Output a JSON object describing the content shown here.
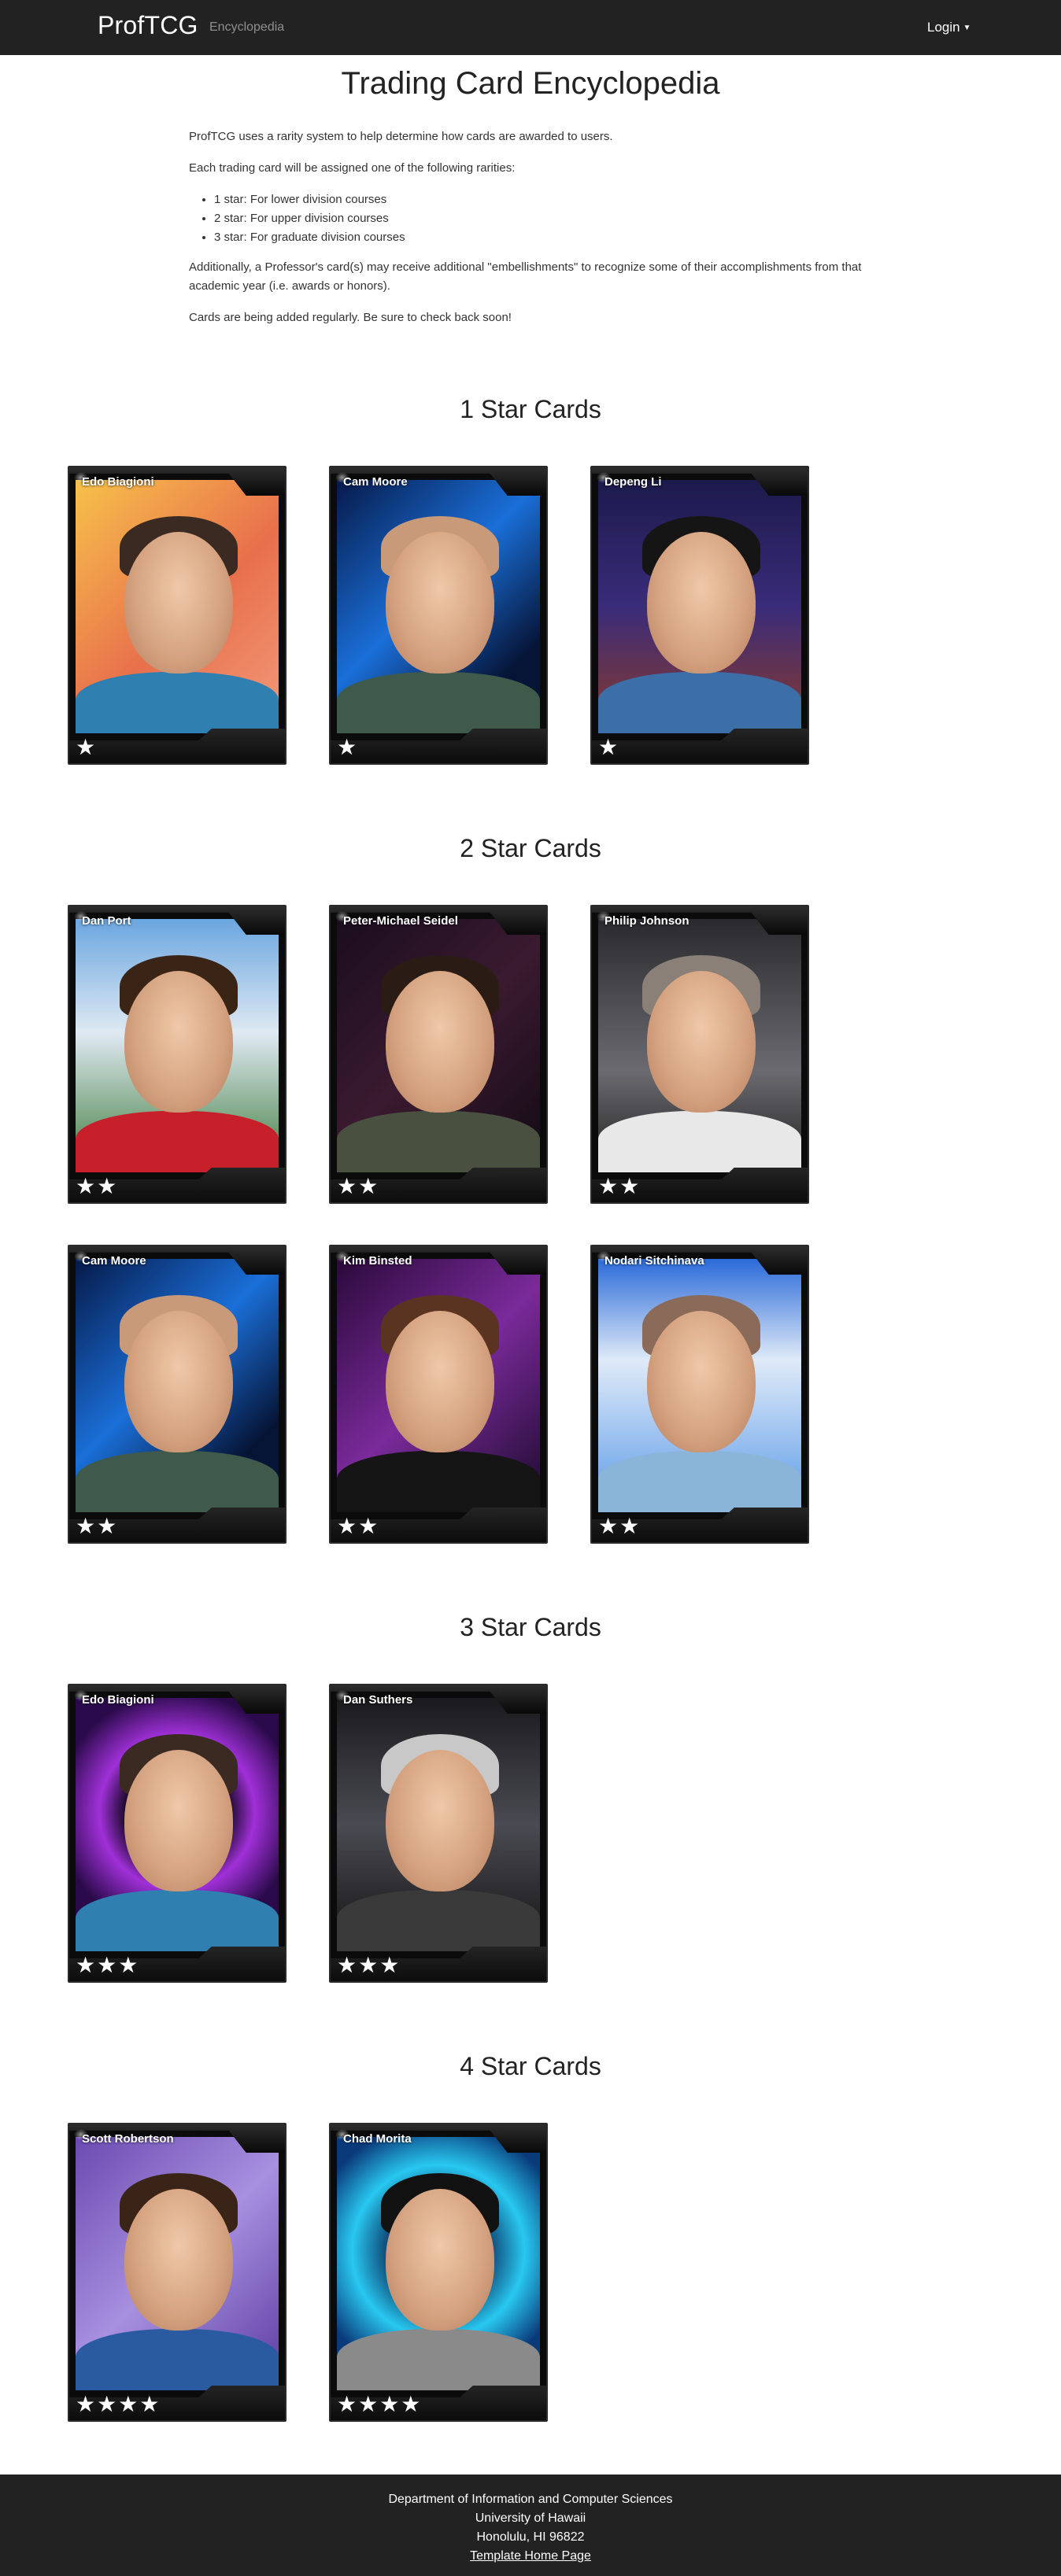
{
  "navbar": {
    "brand": "ProfTCG",
    "link": "Encyclopedia",
    "login": "Login"
  },
  "page": {
    "title": "Trading Card Encyclopedia",
    "intro1": "ProfTCG uses a rarity system to help determine how cards are awarded to users.",
    "intro2": "Each trading card will be assigned one of the following rarities:",
    "rarities": [
      "1 star: For lower division courses",
      "2 star: For upper division courses",
      "3 star: For graduate division courses"
    ],
    "intro3": "Additionally, a Professor's card(s) may receive additional \"embellishments\" to recognize some of their accomplishments from that academic year (i.e. awards or honors).",
    "intro4": "Cards are being added regularly. Be sure to check back soon!"
  },
  "sections": [
    {
      "title": "1 Star Cards",
      "cards": [
        {
          "name": "Edo Biagioni",
          "stars": "★",
          "bg": "linear-gradient(135deg,#f7c14a,#e8704c 55%,#f29a7a)",
          "hair": "#3a2a22",
          "shirt": "#2f7fb0"
        },
        {
          "name": "Cam Moore",
          "stars": "★",
          "bg": "linear-gradient(135deg,#061a4a,#1a6fd8 45%,#061436 80%)",
          "hair": "#c99a7a",
          "shirt": "#3f5a4a"
        },
        {
          "name": "Depeng Li",
          "stars": "★",
          "bg": "linear-gradient(180deg,#1c1a4c,#3a2c7a 50%,#8a3a2a)",
          "hair": "#151515",
          "shirt": "#3c6ea8"
        }
      ]
    },
    {
      "title": "2 Star Cards",
      "cards": [
        {
          "name": "Dan Port",
          "stars": "★★",
          "bg": "linear-gradient(180deg,#6aa6e0,#dfe9f2 45%,#3d7a3a)",
          "hair": "#3a2416",
          "shirt": "#c8202a"
        },
        {
          "name": "Peter-Michael Seidel",
          "stars": "★★",
          "bg": "linear-gradient(135deg,#1a0d1e,#3a1a30 50%,#120a14)",
          "hair": "#2a1c14",
          "shirt": "#4a5040"
        },
        {
          "name": "Philip Johnson",
          "stars": "★★",
          "bg": "linear-gradient(180deg,#2a2a2e,#6a6a70 60%,#222)",
          "hair": "#8a8078",
          "shirt": "#e8e8e8"
        }
      ]
    },
    {
      "title": "",
      "cards": [
        {
          "name": "Cam Moore",
          "stars": "★★",
          "bg": "linear-gradient(135deg,#061a4a,#1a6fd8 45%,#061436 80%)",
          "hair": "#c99a7a",
          "shirt": "#3f5a4a"
        },
        {
          "name": "Kim Binsted",
          "stars": "★★",
          "bg": "linear-gradient(135deg,#2a0a3a,#7a2a9a 50%,#1a0a2a)",
          "hair": "#5a3420",
          "shirt": "#151515"
        },
        {
          "name": "Nodari Sitchinava",
          "stars": "★★",
          "bg": "linear-gradient(180deg,#2a6ad8,#dfeaf8 40%,#5a9ae8)",
          "hair": "#8a6a58",
          "shirt": "#8ab4d8"
        }
      ]
    },
    {
      "title": "3 Star Cards",
      "cards": [
        {
          "name": "Edo Biagioni",
          "stars": "★★★",
          "bg": "radial-gradient(circle at 50% 45%,#1a0a2a 30%,#a030d8 45%,#2a0a4a 70%)",
          "hair": "#3a2a22",
          "shirt": "#2f7fb0"
        },
        {
          "name": "Dan Suthers",
          "stars": "★★★",
          "bg": "linear-gradient(180deg,#1a1a1e,#4a4a52 50%,#141414)",
          "hair": "#c8c8c8",
          "shirt": "#3a3a3a"
        }
      ]
    },
    {
      "title": "4 Star Cards",
      "cards": [
        {
          "name": "Scott Robertson",
          "stars": "★★★★",
          "bg": "linear-gradient(135deg,#6a4ab0,#a890e0 50%,#5a3aa0)",
          "hair": "#3a2418",
          "shirt": "#2a5aa0"
        },
        {
          "name": "Chad Morita",
          "stars": "★★★★",
          "bg": "radial-gradient(circle at 50% 45%,#0a2a5a 25%,#28c8f0 50%,#0a3a7a 75%)",
          "hair": "#121212",
          "shirt": "#8a8a8a"
        }
      ]
    }
  ],
  "footer": {
    "line1": "Department of Information and Computer Sciences",
    "line2": "University of Hawaii",
    "line3": "Honolulu, HI 96822",
    "link": "Template Home Page"
  }
}
